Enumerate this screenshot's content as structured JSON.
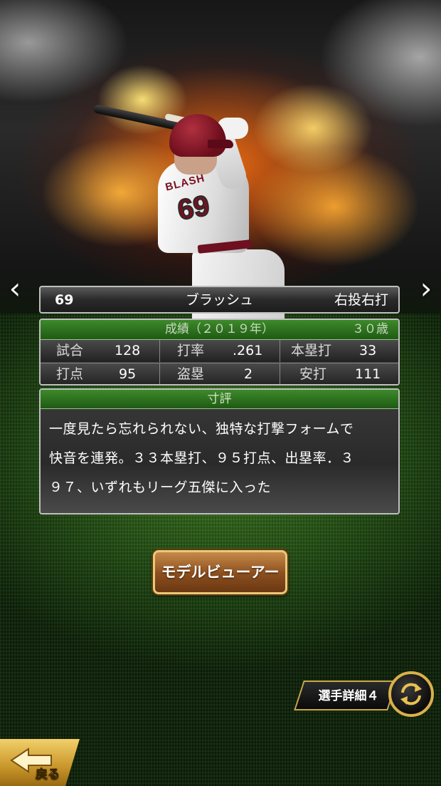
{
  "player": {
    "number": "69",
    "name": "ブラッシュ",
    "throw_bat": "右投右打",
    "jersey_name": "BLASH",
    "jersey_number": "69"
  },
  "stats": {
    "header": "成績（２０１９年）",
    "age": "３０歳",
    "rows": [
      [
        {
          "label": "試合",
          "value": "128"
        },
        {
          "label": "打率",
          "value": ".261"
        },
        {
          "label": "本塁打",
          "value": "33"
        }
      ],
      [
        {
          "label": "打点",
          "value": "95"
        },
        {
          "label": "盗塁",
          "value": "2"
        },
        {
          "label": "安打",
          "value": "111"
        }
      ]
    ]
  },
  "evaluation": {
    "header": "寸評",
    "lines": [
      "一度見たら忘れられない、独特な打撃フォームで",
      "快音を連発。３３本塁打、９５打点、出塁率．３",
      "９７、いずれもリーグ五傑に入った"
    ]
  },
  "buttons": {
    "model_viewer": "モデルビューアー",
    "player_detail": "選手詳細４",
    "back": "戻る",
    "prev_arrow": "‹",
    "next_arrow": "›"
  },
  "icons": {
    "prev": "chevron-left-icon",
    "next": "chevron-right-icon",
    "cycle": "cycle-arrows-icon",
    "back": "back-arrow-icon"
  },
  "colors": {
    "panel_header_green": "#2e7220",
    "button_gold": "#e9c978",
    "button_brown": "#8a4e1e",
    "back_gold": "#f2d06a"
  }
}
